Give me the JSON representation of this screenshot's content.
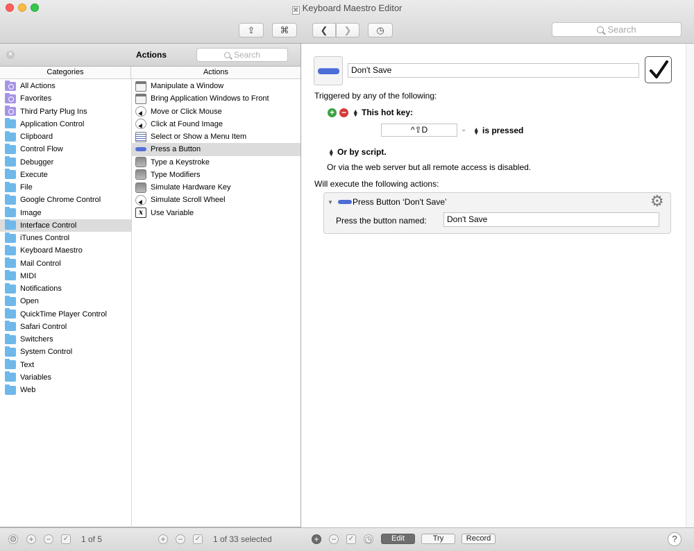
{
  "window": {
    "title": "Keyboard Maestro Editor"
  },
  "toolbar": {
    "share_glyph": "⇪",
    "command_glyph": "⌘",
    "back_glyph": "❮",
    "forward_glyph": "❯",
    "history_glyph": "◷",
    "search_placeholder": "Search"
  },
  "actions_panel": {
    "title": "Actions",
    "close_glyph": "×",
    "search_placeholder": "Search",
    "categories_header": "Categories",
    "actions_header": "Actions",
    "categories": [
      {
        "label": "All Actions",
        "icon": "smart-folder-icon"
      },
      {
        "label": "Favorites",
        "icon": "smart-folder-icon"
      },
      {
        "label": "Third Party Plug Ins",
        "icon": "smart-folder-icon"
      },
      {
        "label": "Application Control",
        "icon": "folder-icon"
      },
      {
        "label": "Clipboard",
        "icon": "folder-icon"
      },
      {
        "label": "Control Flow",
        "icon": "folder-icon"
      },
      {
        "label": "Debugger",
        "icon": "folder-icon"
      },
      {
        "label": "Execute",
        "icon": "folder-icon"
      },
      {
        "label": "File",
        "icon": "folder-icon"
      },
      {
        "label": "Google Chrome Control",
        "icon": "folder-icon"
      },
      {
        "label": "Image",
        "icon": "folder-icon"
      },
      {
        "label": "Interface Control",
        "icon": "folder-icon",
        "selected": true
      },
      {
        "label": "iTunes Control",
        "icon": "folder-icon"
      },
      {
        "label": "Keyboard Maestro",
        "icon": "folder-icon"
      },
      {
        "label": "Mail Control",
        "icon": "folder-icon"
      },
      {
        "label": "MIDI",
        "icon": "folder-icon"
      },
      {
        "label": "Notifications",
        "icon": "folder-icon"
      },
      {
        "label": "Open",
        "icon": "folder-icon"
      },
      {
        "label": "QuickTime Player Control",
        "icon": "folder-icon"
      },
      {
        "label": "Safari Control",
        "icon": "folder-icon"
      },
      {
        "label": "Switchers",
        "icon": "folder-icon"
      },
      {
        "label": "System Control",
        "icon": "folder-icon"
      },
      {
        "label": "Text",
        "icon": "folder-icon"
      },
      {
        "label": "Variables",
        "icon": "folder-icon"
      },
      {
        "label": "Web",
        "icon": "folder-icon"
      }
    ],
    "actions": [
      {
        "label": "Manipulate a Window",
        "icon": "window-icon"
      },
      {
        "label": "Bring Application Windows to Front",
        "icon": "window-icon"
      },
      {
        "label": "Move or Click Mouse",
        "icon": "mouse-cursor-icon"
      },
      {
        "label": "Click at Found Image",
        "icon": "mouse-cursor-icon"
      },
      {
        "label": "Select or Show a Menu Item",
        "icon": "menu-icon"
      },
      {
        "label": "Press a Button",
        "icon": "button-icon",
        "selected": true
      },
      {
        "label": "Type a Keystroke",
        "icon": "key-icon"
      },
      {
        "label": "Type Modifiers",
        "icon": "key-icon"
      },
      {
        "label": "Simulate Hardware Key",
        "icon": "key-icon"
      },
      {
        "label": "Simulate Scroll Wheel",
        "icon": "mouse-cursor-icon"
      },
      {
        "label": "Use Variable",
        "icon": "variable-icon"
      }
    ]
  },
  "editor": {
    "macro_name": "Don't Save",
    "enabled": true,
    "triggered_label": "Triggered by any of the following:",
    "hotkey_label": "This hot key:",
    "hotkey_value": "^⇧D",
    "pressed_label": "is pressed",
    "script_label": "Or by script.",
    "web_server_note": "Or via the web server but all remote access is disabled.",
    "execute_label": "Will execute the following actions:",
    "action": {
      "title": "Press Button ‘Don't Save’",
      "field_label": "Press the button named:",
      "field_value": "Don't Save"
    }
  },
  "bottom_bar": {
    "left_count": "1 of 5",
    "middle_count": "1 of 33 selected",
    "edit_label": "Edit",
    "try_label": "Try",
    "record_label": "Record",
    "help_glyph": "?"
  },
  "colors": {
    "accent_blue": "#4c6cd6",
    "folder_blue": "#6fb8ea",
    "smart_folder_purple": "#a794e6",
    "add_green": "#3ba142",
    "remove_red": "#d43b3b"
  }
}
